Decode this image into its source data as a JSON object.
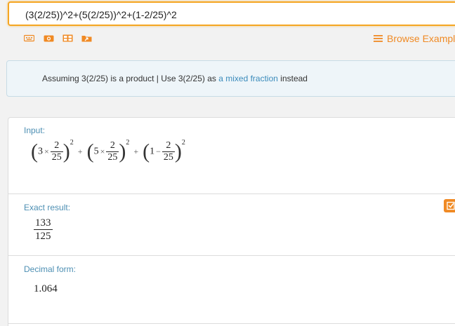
{
  "query": {
    "text": "(3(2/25))^2+(5(2/25))^2+(1-2/25)^2"
  },
  "toolbar": {
    "icons": [
      "keyboard-icon",
      "camera-icon",
      "table-icon",
      "upload-icon"
    ],
    "browse_label": "Browse Examples",
    "accent": "#f08a24"
  },
  "assumption": {
    "prefix": "Assuming 3(2/25) is a product | Use 3(2/25) as ",
    "link": "a mixed fraction",
    "suffix": " instead"
  },
  "pods": {
    "input": {
      "title": "Input:",
      "term1": {
        "coef": "3",
        "num": "2",
        "den": "25",
        "exp": "2"
      },
      "term2": {
        "coef": "5",
        "num": "2",
        "den": "25",
        "exp": "2"
      },
      "term3": {
        "lead": "1",
        "num": "2",
        "den": "25",
        "exp": "2"
      },
      "times": "×",
      "plus": "+",
      "minus": "−"
    },
    "exact": {
      "title": "Exact result:",
      "num": "133",
      "den": "125"
    },
    "decimal": {
      "title": "Decimal form:",
      "value": "1.064"
    }
  }
}
